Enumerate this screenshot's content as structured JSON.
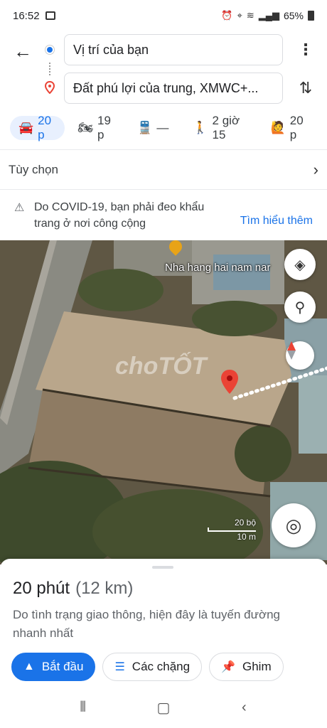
{
  "status_bar": {
    "time": "16:52",
    "battery": "65%"
  },
  "search": {
    "origin": "Vị trí của bạn",
    "destination": "Đất phú lợi của trung, XMWC+..."
  },
  "modes": [
    {
      "icon": "car-icon",
      "label": "20 p",
      "active": true
    },
    {
      "icon": "motorcycle-icon",
      "label": "19 p"
    },
    {
      "icon": "transit-icon",
      "label": "—"
    },
    {
      "icon": "walk-icon",
      "label": "2 giờ 15"
    },
    {
      "icon": "ride-icon",
      "label": "20 p"
    }
  ],
  "options": {
    "label": "Tùy chọn"
  },
  "covid": {
    "message": "Do COVID-19, bạn phải đeo khẩu trang ở nơi công cộng",
    "link": "Tìm hiểu thêm"
  },
  "map": {
    "place_label": "Nha hang hai nam nar",
    "watermark": "choTỐT",
    "scale_ft": "20 bộ",
    "scale_m": "10 m"
  },
  "sheet": {
    "duration": "20 phút",
    "distance": "(12 km)",
    "note": "Do tình trạng giao thông, hiện đây là tuyến đường nhanh nhất",
    "start_label": "Bắt đầu",
    "steps_label": "Các chặng",
    "pin_label": "Ghim"
  },
  "colors": {
    "accent": "#1a73e8",
    "destination_pin": "#ea4335"
  }
}
